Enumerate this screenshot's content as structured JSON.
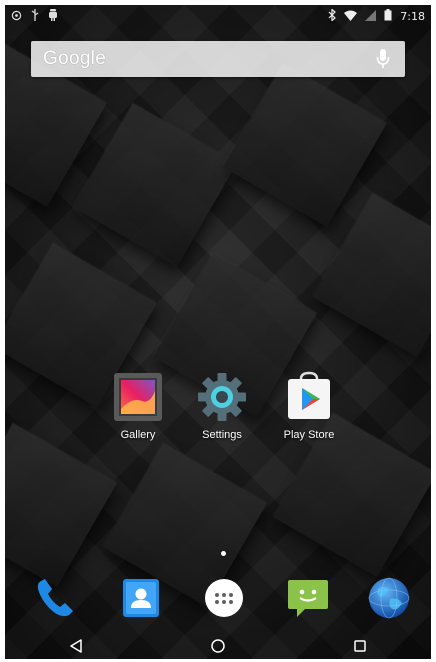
{
  "status_bar": {
    "time": "7:18",
    "left_icons": [
      "sync-icon",
      "usb-icon",
      "android-debug-icon"
    ],
    "right_icons": [
      "bluetooth-icon",
      "wifi-icon",
      "no-signal-icon",
      "battery-icon"
    ]
  },
  "search": {
    "label": "Google",
    "mic_icon": "mic-icon"
  },
  "home_apps": [
    {
      "label": "Gallery",
      "icon": "gallery-icon"
    },
    {
      "label": "Settings",
      "icon": "settings-icon"
    },
    {
      "label": "Play Store",
      "icon": "play-store-icon"
    }
  ],
  "dock": [
    {
      "icon": "phone-icon"
    },
    {
      "icon": "contacts-icon"
    },
    {
      "icon": "app-drawer-icon"
    },
    {
      "icon": "messaging-icon"
    },
    {
      "icon": "browser-icon"
    }
  ],
  "nav": {
    "back_icon": "back-icon",
    "home_icon": "home-icon",
    "recents_icon": "recents-icon"
  },
  "colors": {
    "wallpaper": "#1a1a1a",
    "phone_blue": "#1e88e5",
    "messaging_green": "#8bc34a",
    "contacts_blue": "#1e88e5",
    "settings_teal": "#4dd0e1"
  }
}
